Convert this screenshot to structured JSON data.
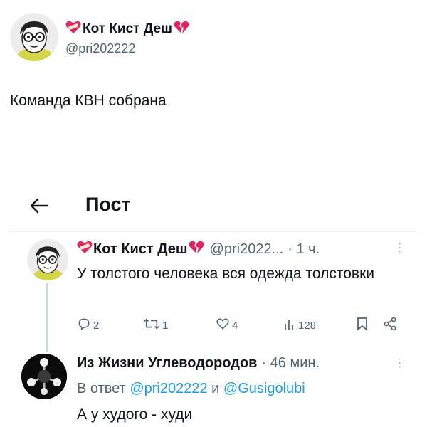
{
  "top_post": {
    "author_name": "Кот Кист Деш",
    "handle": "@pri202222",
    "text": "Команда КВН собрана"
  },
  "header": {
    "title": "Пост"
  },
  "tweet1": {
    "author_name": "Кот Кист Деш",
    "handle": "@pri2022...",
    "time": "· 1 ч.",
    "text": "У толстого человека вся одежда толстовки",
    "replies": "2",
    "retweets": "1",
    "likes": "4",
    "views": "128"
  },
  "tweet2": {
    "author_name": "Из Жизни Углеводородов",
    "time": "· 46 мин.",
    "reply_prefix": "В ответ",
    "reply_to_1": "@pri202222",
    "reply_conjunction": "и",
    "reply_to_2": "@Gusigolubi",
    "text": "А у худого - худи"
  },
  "colors": {
    "link": "#1d9bf0",
    "muted": "#536471",
    "heart_red": "#e0245e"
  }
}
